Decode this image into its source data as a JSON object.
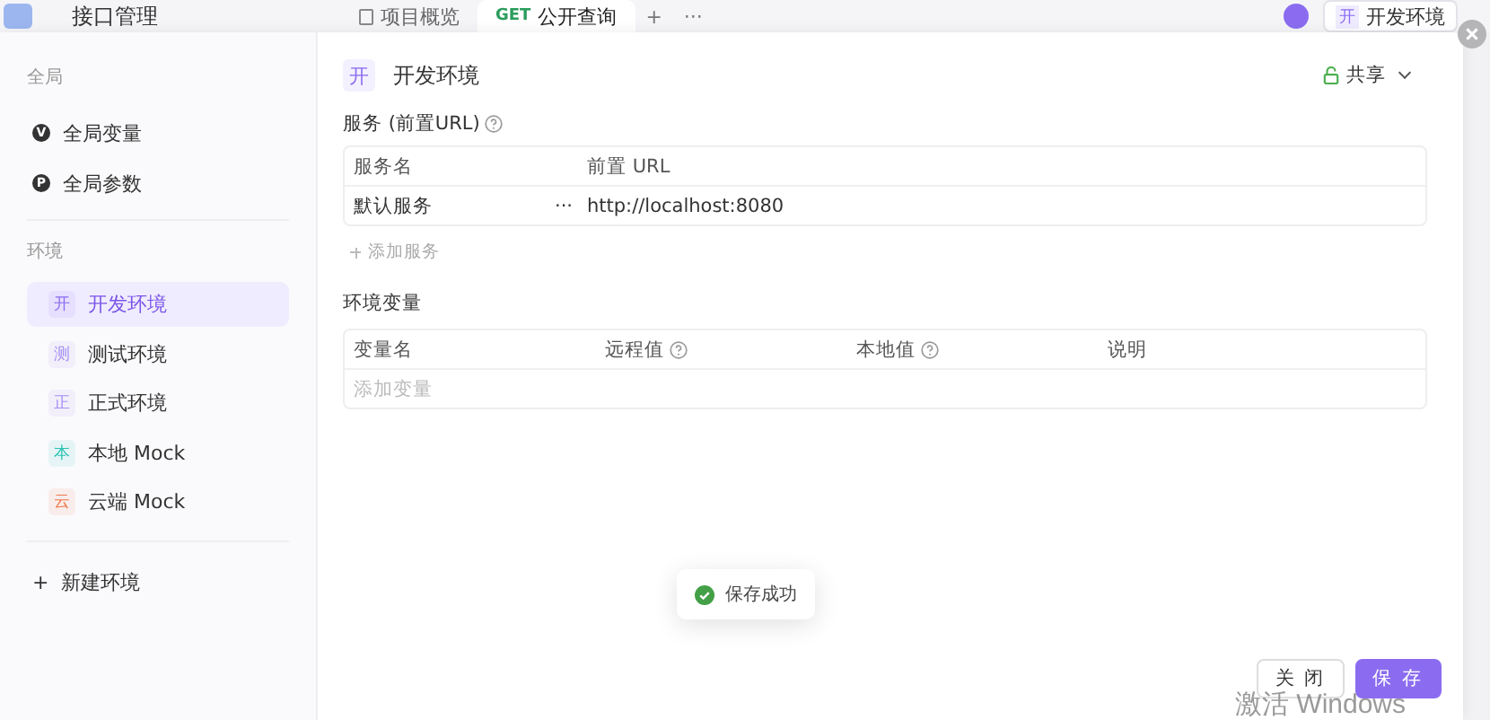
{
  "header": {
    "title": "接口管理",
    "tabs": [
      {
        "label": "项目概览",
        "selected": false
      },
      {
        "method": "GET",
        "label": "公开查询",
        "selected": true
      }
    ],
    "add_tab": "+",
    "more": "···",
    "env_selector": {
      "badge": "开",
      "label": "开发环境"
    }
  },
  "sidebar": {
    "global_title": "全局",
    "global_items": [
      {
        "letter": "V",
        "label": "全局变量"
      },
      {
        "letter": "P",
        "label": "全局参数"
      }
    ],
    "env_title": "环境",
    "environments": [
      {
        "badge": "开",
        "name": "开发环境",
        "color": "#8b6cf0",
        "selected": true
      },
      {
        "badge": "测",
        "name": "测试环境",
        "color": "#a58ff2",
        "selected": false
      },
      {
        "badge": "正",
        "name": "正式环境",
        "color": "#a58ff2",
        "selected": false
      },
      {
        "badge": "本",
        "name": "本地 Mock",
        "color": "#2cc3b5",
        "selected": false
      },
      {
        "badge": "云",
        "name": "云端 Mock",
        "color": "#f0764a",
        "selected": false
      }
    ],
    "new_env": {
      "icon": "+",
      "label": "新建环境"
    }
  },
  "main": {
    "badge": "开",
    "title": "开发环境",
    "share": "共享",
    "services": {
      "title": "服务 (前置URL)",
      "columns": [
        "服务名",
        "前置 URL"
      ],
      "rows": [
        {
          "name": "默认服务",
          "more": "···",
          "url": "http://localhost:8080"
        }
      ],
      "add": "添加服务"
    },
    "variables": {
      "title": "环境变量",
      "columns": [
        {
          "label": "变量名",
          "help": false
        },
        {
          "label": "远程值",
          "help": true
        },
        {
          "label": "本地值",
          "help": true
        },
        {
          "label": "说明",
          "help": false
        }
      ],
      "placeholder": "添加变量"
    },
    "buttons": {
      "close": "关 闭",
      "save": "保 存"
    }
  },
  "toast": {
    "text": "保存成功"
  },
  "os_notice": "激活 Windows"
}
